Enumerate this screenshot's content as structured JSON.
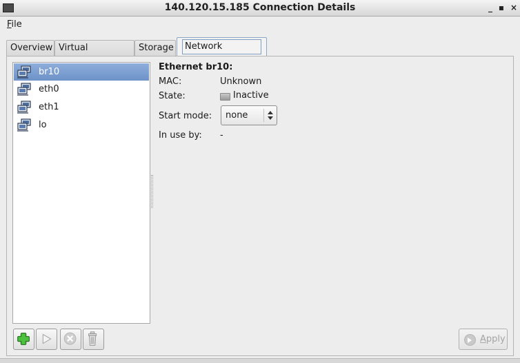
{
  "window": {
    "title": "140.120.15.185 Connection Details",
    "controls": {
      "minimize": "_",
      "maximize": "▪",
      "close": "×"
    }
  },
  "menubar": {
    "file_mnemonic": "F",
    "file_rest": "ile"
  },
  "tabs": [
    {
      "label": "Overview"
    },
    {
      "label": "Virtual Networks"
    },
    {
      "label": "Storage"
    },
    {
      "label": "Network Interfaces",
      "selected": true
    }
  ],
  "interfaces": [
    {
      "name": "br10",
      "icon": "network-interface-icon",
      "selected": true
    },
    {
      "name": "eth0",
      "icon": "network-interface-icon"
    },
    {
      "name": "eth1",
      "icon": "network-interface-icon"
    },
    {
      "name": "lo",
      "icon": "network-interface-icon"
    }
  ],
  "details": {
    "heading": "Ethernet br10:",
    "mac_label": "MAC:",
    "mac_value": "Unknown",
    "state_label": "State:",
    "state_value": "Inactive",
    "state_icon": "inactive-monitor-icon",
    "start_mode_label": "Start mode:",
    "start_mode_value": "none",
    "in_use_label": "In use by:",
    "in_use_value": "-"
  },
  "toolbar": {
    "add_icon": "add-icon",
    "start_icon": "play-icon",
    "stop_icon": "stop-icon",
    "delete_icon": "trash-icon"
  },
  "apply": {
    "mnemonic": "A",
    "rest": "pply",
    "enabled": false
  },
  "colors": {
    "selection": "#7a9ccf",
    "add_green": "#3aa52e"
  }
}
